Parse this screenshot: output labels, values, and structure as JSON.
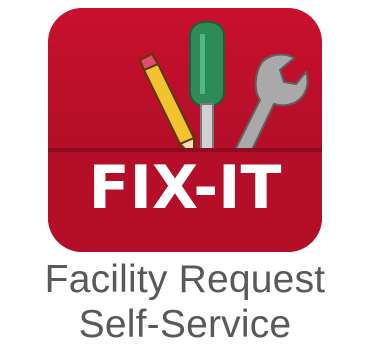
{
  "app": {
    "logo_text": "FIX-IT",
    "label_line1": "Facility Request",
    "label_line2": "Self-Service",
    "icons": [
      "pencil-icon",
      "screwdriver-icon",
      "wrench-icon"
    ]
  },
  "colors": {
    "tile_red": "#c8102e",
    "tile_red_dark": "#a50d24",
    "text_gray": "#595959",
    "screwdriver_green": "#2e8b57",
    "pencil_yellow": "#f2c230",
    "wrench_gray": "#a9a9a9"
  }
}
